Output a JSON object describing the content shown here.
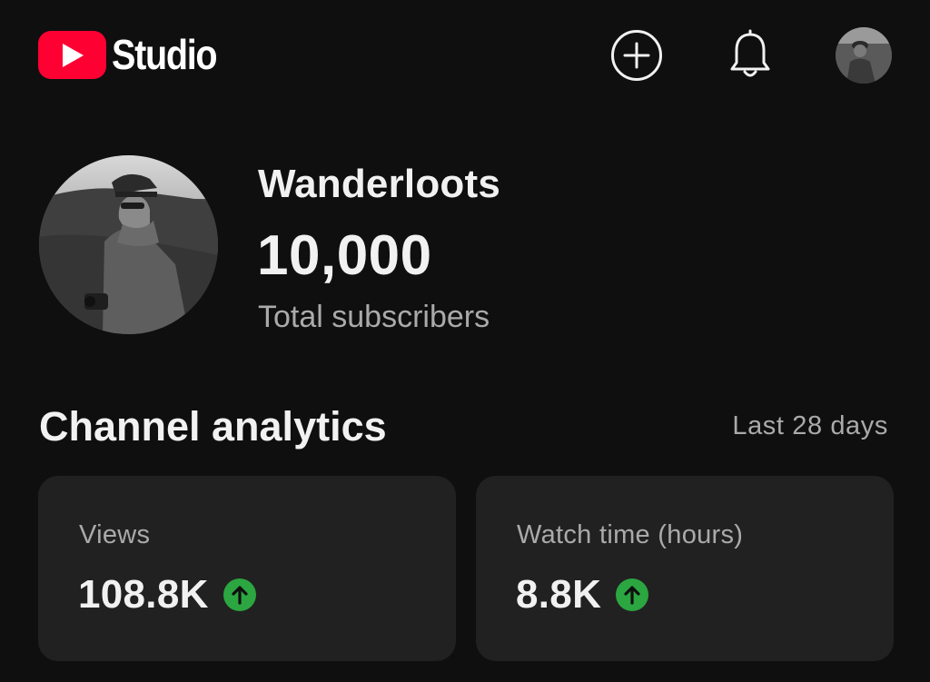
{
  "header": {
    "logo_text": "Studio",
    "logo_icon": "youtube-play-icon",
    "create_icon": "add-circle-icon",
    "notifications_icon": "bell-icon",
    "account_icon": "account-avatar"
  },
  "channel": {
    "name": "Wanderloots",
    "subscribers": "10,000",
    "subscribers_label": "Total subscribers"
  },
  "analytics": {
    "title": "Channel analytics",
    "period": "Last 28 days",
    "cards": [
      {
        "label": "Views",
        "value": "108.8K",
        "trend": "up",
        "trend_icon": "arrow-up-icon"
      },
      {
        "label": "Watch time (hours)",
        "value": "8.8K",
        "trend": "up",
        "trend_icon": "arrow-up-icon"
      }
    ]
  },
  "colors": {
    "background": "#0f0f0f",
    "card": "#212121",
    "brand_red": "#ff0033",
    "trend_green": "#2ba640",
    "secondary_text": "#aaaaaa"
  }
}
